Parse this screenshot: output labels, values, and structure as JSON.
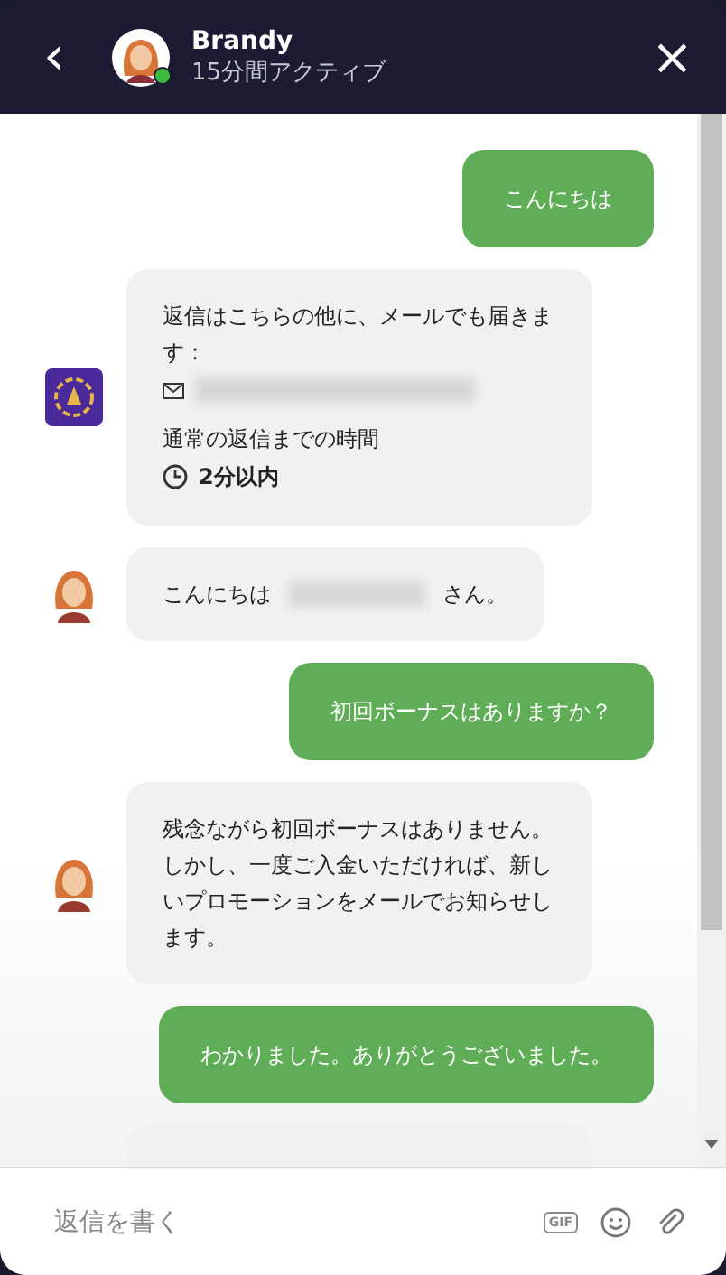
{
  "header": {
    "back": "‹",
    "name": "Brandy",
    "status": "15分間アクティブ",
    "online": true,
    "close": "×"
  },
  "messages": [
    {
      "kind": "sent",
      "text": "こんにちは"
    },
    {
      "kind": "info",
      "avatar": {
        "kind": "bot"
      },
      "text": "返信はこちらの他に、メールでも届きます：",
      "redacted": true,
      "label": "通常の返信までの時間",
      "time": "2分以内"
    },
    {
      "kind": "received",
      "avatar": {
        "kind": "agent"
      },
      "text": "こんにちは",
      "redacted": true,
      "after": "さん。"
    },
    {
      "kind": "sent",
      "text": "初回ボーナスはありますか？"
    },
    {
      "kind": "received",
      "avatar": {
        "kind": "agent"
      },
      "text": "残念ながら初回ボーナスはありません。しかし、一度ご入金いただければ、新しいプロモーションをメールでお知らせします。"
    },
    {
      "kind": "sent",
      "text": "わかりました。ありがとうございました。"
    },
    {
      "kind": "cut"
    }
  ],
  "composer": {
    "placeholder": "返信を書く",
    "gif": "GIF"
  }
}
